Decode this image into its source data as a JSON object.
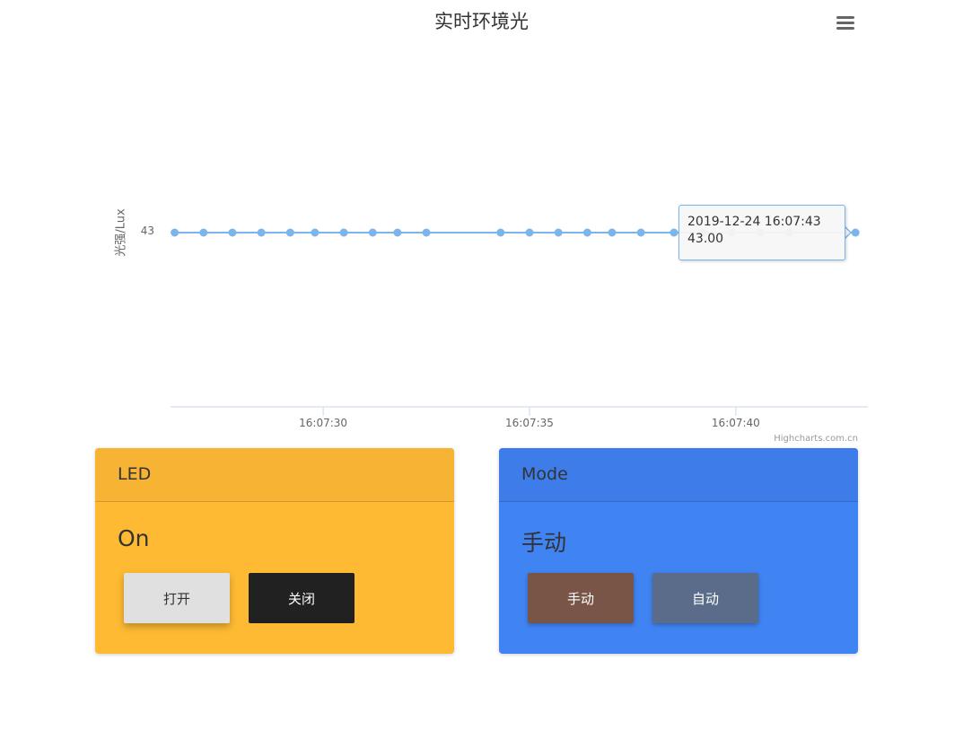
{
  "chart_data": {
    "type": "line",
    "title": "实时环境光",
    "ylabel": "光强/Lux",
    "xlabel": "",
    "y_ticks": [
      "43"
    ],
    "x_ticks": [
      "16:07:30",
      "16:07:35",
      "16:07:40"
    ],
    "xlim": [
      "16:07:26.3",
      "16:07:43.2"
    ],
    "series": [
      {
        "x": [
          "16:07:26.4",
          "16:07:27.1",
          "16:07:27.8",
          "16:07:28.5",
          "16:07:29.2",
          "16:07:29.8",
          "16:07:30.5",
          "16:07:31.2",
          "16:07:31.8",
          "16:07:32.5",
          "16:07:34.3",
          "16:07:35.0",
          "16:07:35.7",
          "16:07:36.4",
          "16:07:37.0",
          "16:07:37.7",
          "16:07:38.5",
          "16:07:39.2",
          "16:07:39.9",
          "16:07:40.6",
          "16:07:41.3",
          "16:07:42.9"
        ],
        "y": [
          43,
          43,
          43,
          43,
          43,
          43,
          43,
          43,
          43,
          43,
          43,
          43,
          43,
          43,
          43,
          43,
          43,
          43,
          43,
          43,
          43,
          43
        ]
      }
    ],
    "color": "#7cb5ec",
    "grid": false,
    "credits": "Highcharts.com.cn",
    "tooltip": {
      "time": "2019-12-24 16:07:43",
      "value": "43.00"
    }
  },
  "menu": {
    "icon": "hamburger-menu-icon"
  },
  "led_card": {
    "title": "LED",
    "status": "On",
    "on_label": "打开",
    "off_label": "关闭",
    "bg_color": "#fdba32"
  },
  "mode_card": {
    "title": "Mode",
    "status": "手动",
    "manual_label": "手动",
    "auto_label": "自动",
    "bg_color": "#4083f2"
  }
}
